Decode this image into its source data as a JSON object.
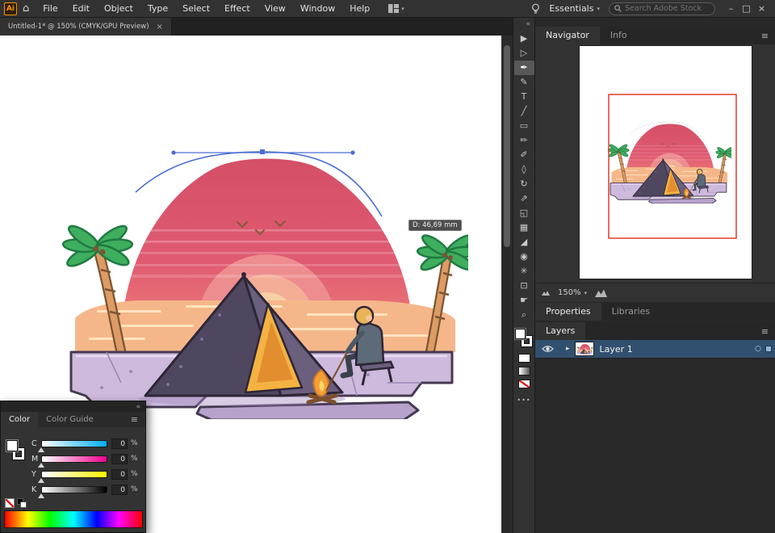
{
  "menubar": {
    "app_logo": "Ai",
    "menus": [
      "File",
      "Edit",
      "Object",
      "Type",
      "Select",
      "Effect",
      "View",
      "Window",
      "Help"
    ],
    "workspace_label": "Essentials",
    "search_placeholder": "Search Adobe Stock",
    "window_controls": {
      "minimize": "–",
      "maximize": "□",
      "close": "×"
    }
  },
  "tabbar": {
    "document_tab": "Untitled-1* @ 150% (CMYK/GPU Preview)",
    "close": "×"
  },
  "toolbar": {
    "collapse": "«",
    "more": "•••",
    "tools": [
      {
        "name": "selection-tool",
        "glyph": "▶"
      },
      {
        "name": "direct-selection-tool",
        "glyph": "▷"
      },
      {
        "name": "pen-tool",
        "glyph": "✒"
      },
      {
        "name": "curvature-tool",
        "glyph": "✎"
      },
      {
        "name": "type-tool",
        "glyph": "T"
      },
      {
        "name": "line-segment-tool",
        "glyph": "╱"
      },
      {
        "name": "rectangle-tool",
        "glyph": "▭"
      },
      {
        "name": "paintbrush-tool",
        "glyph": "✏"
      },
      {
        "name": "pencil-tool",
        "glyph": "✐"
      },
      {
        "name": "eraser-tool",
        "glyph": "◊"
      },
      {
        "name": "rotate-tool",
        "glyph": "↻"
      },
      {
        "name": "scale-tool",
        "glyph": "⇗"
      },
      {
        "name": "shape-builder-tool",
        "glyph": "◱"
      },
      {
        "name": "gradient-tool",
        "glyph": "▦"
      },
      {
        "name": "eyedropper-tool",
        "glyph": "◢"
      },
      {
        "name": "blend-tool",
        "glyph": "◉"
      },
      {
        "name": "symbol-sprayer-tool",
        "glyph": "✳"
      },
      {
        "name": "artboard-tool",
        "glyph": "⊡"
      },
      {
        "name": "hand-tool",
        "glyph": "☛"
      },
      {
        "name": "zoom-tool",
        "glyph": "⌕"
      }
    ]
  },
  "navigator": {
    "title": "Navigator",
    "info_tab": "Info",
    "zoom_value": "150%"
  },
  "properties_tabs": {
    "properties": "Properties",
    "libraries": "Libraries"
  },
  "layers": {
    "title": "Layers",
    "layer_name": "Layer 1"
  },
  "color_panel": {
    "collapse": "«",
    "tab_color": "Color",
    "tab_color_guide": "Color Guide",
    "sliders": [
      {
        "label": "C",
        "value": "0",
        "unit": "%"
      },
      {
        "label": "M",
        "value": "0",
        "unit": "%"
      },
      {
        "label": "Y",
        "value": "0",
        "unit": "%"
      },
      {
        "label": "K",
        "value": "0",
        "unit": "%"
      }
    ]
  },
  "canvas": {
    "measurement_tooltip": "D: 46,69 mm"
  },
  "colors": {
    "ui_panel": "#323232",
    "ui_dark": "#262626",
    "selection_row_blue": "#31506f",
    "path_accent_blue": "#4a6fd4",
    "navigator_viewbox_red": "#e03a2c",
    "dome_pink": "#e05a72",
    "sand_orange": "#f5b78a",
    "palm_green": "#3fae5e",
    "tent_purple": "#4f4660",
    "door_yellow": "#f4b242",
    "platform_lavender": "#cdbadd"
  }
}
